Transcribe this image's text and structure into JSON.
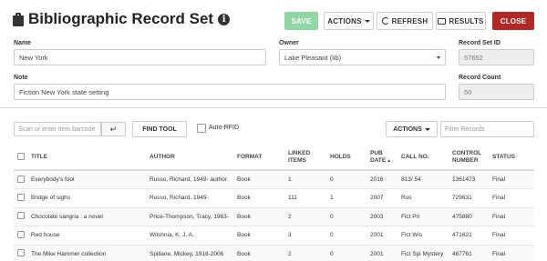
{
  "header": {
    "title": "Bibliographic Record Set",
    "buttons": {
      "save": "SAVE",
      "actions": "ACTIONS",
      "refresh": "REFRESH",
      "results": "RESULTS",
      "close": "CLOSE"
    }
  },
  "form": {
    "name_label": "Name",
    "name_value": "New York",
    "owner_label": "Owner",
    "owner_value": "Lake Pleasant (lib)",
    "record_set_id_label": "Record Set ID",
    "record_set_id_value": "57652",
    "note_label": "Note",
    "note_value": "Fiction New York state setting",
    "record_count_label": "Record Count",
    "record_count_value": "50"
  },
  "toolbar": {
    "scan_placeholder": "Scan or enter item barcode",
    "enter_glyph": "↵",
    "find_tool": "FIND TOOL",
    "auto_rfid": "Auto-RFID",
    "actions": "ACTIONS",
    "filter_placeholder": "Filter Records"
  },
  "table": {
    "columns": [
      "TITLE",
      "AUTHOR",
      "FORMAT",
      "LINKED ITEMS",
      "HOLDS",
      "PUB DATE",
      "CALL NO.",
      "CONTROL NUMBER",
      "STATUS"
    ],
    "sort_indicator": "▲",
    "rows": [
      {
        "title": "Everybody's fool",
        "author": "Russo, Richard, 1949- author.",
        "format": "Book",
        "linked": "1",
        "holds": "0",
        "pub": "2016",
        "call": "813/ 54",
        "control": "1361473",
        "status": "Final"
      },
      {
        "title": "Bridge of sighs",
        "author": "Russo, Richard, 1949-",
        "format": "Book",
        "linked": "111",
        "holds": "1",
        "pub": "2007",
        "call": "Rus",
        "control": "729631",
        "status": "Final"
      },
      {
        "title": "Chocolate sangria : a novel",
        "author": "Price-Thompson, Tracy, 1963-",
        "format": "Book",
        "linked": "2",
        "holds": "0",
        "pub": "2003",
        "call": "Fict Pri",
        "control": "475880",
        "status": "Final"
      },
      {
        "title": "Red house",
        "author": "Wilshnia, K. J. A.",
        "format": "Book",
        "linked": "3",
        "holds": "0",
        "pub": "2001",
        "call": "Fict Wis",
        "control": "471621",
        "status": "Final"
      },
      {
        "title": "The Mike Hammer collection",
        "author": "Spillane, Mickey, 1918-2006",
        "format": "Book",
        "linked": "2",
        "holds": "0",
        "pub": "2001",
        "call": "Fict Spi Mystery",
        "control": "467761",
        "status": "Final"
      }
    ]
  }
}
